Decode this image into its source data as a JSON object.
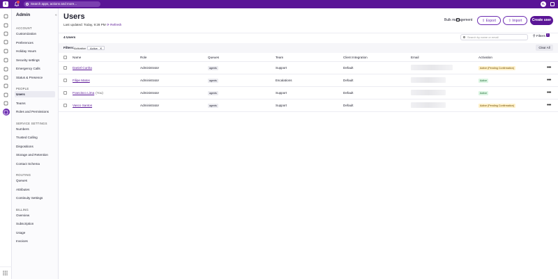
{
  "topbar": {
    "logo_text": "t",
    "search_placeholder": "Search apps, actions and more...",
    "avatar_initials": "FL"
  },
  "rail_icons": [
    "home-icon",
    "workflows-icon",
    "chat-icon",
    "org-chart-icon",
    "book-icon",
    "code-icon",
    "edit-icon",
    "phone-icon",
    "scale-icon",
    "cloud-icon",
    "compass-icon",
    "admin-settings-icon"
  ],
  "sidebar": {
    "title": "Admin",
    "sections": [
      {
        "label": "ACCOUNT",
        "items": [
          "Customization",
          "Preferences",
          "Holiday Hours",
          "Security settings",
          "Emergency Calls",
          "Status & Presence"
        ]
      },
      {
        "label": "PEOPLE",
        "items": [
          "Users",
          "Teams",
          "Roles and Permissions"
        ]
      },
      {
        "label": "SERVICE SETTINGS",
        "items": [
          "Numbers",
          "Trusted Calling",
          "Dispositions",
          "Storage and Retention",
          "Contact Schema"
        ]
      },
      {
        "label": "ROUTING",
        "items": [
          "Queues",
          "Attributes",
          "Continuity Settings"
        ]
      },
      {
        "label": "BILLING",
        "items": [
          "Overview",
          "Subscription",
          "Usage",
          "Invoices"
        ]
      }
    ],
    "active_item": "Users"
  },
  "main": {
    "title": "Users",
    "last_updated": "Last updated: Today, 9:28 PM",
    "refresh_label": "Refresh",
    "bulk_label": "Bulk management",
    "export_label": "Export",
    "import_label": "Import",
    "create_label": "Create user",
    "count_label": "4 Users",
    "search_placeholder": "Search by name or email",
    "filters_label": "Filters",
    "filters_count": "1",
    "filter_prefix": "Filters:",
    "filter_field": "Activation",
    "filter_value": "Active",
    "filter_remove": "✕",
    "clear_all_label": "Clear All"
  },
  "table": {
    "columns": [
      "Name",
      "Role",
      "Queues",
      "Team",
      "Client Integration",
      "Email",
      "Activation"
    ],
    "rows": [
      {
        "name": "Daniel Cunha",
        "suffix": "",
        "role": "Administrator",
        "queue": "agents",
        "team": "Support",
        "integration": "Default",
        "activation": "Active (Pending Confirmation)",
        "status": "pending"
      },
      {
        "name": "Filipe Matos",
        "suffix": "",
        "role": "Administrator",
        "queue": "agents",
        "team": "Escalations",
        "integration": "Default",
        "activation": "Active",
        "status": "active"
      },
      {
        "name": "Francisco Lima",
        "suffix": "(You)",
        "role": "Administrator",
        "queue": "agents",
        "team": "Support",
        "integration": "Default",
        "activation": "Active",
        "status": "active"
      },
      {
        "name": "Vasco Santos",
        "suffix": "",
        "role": "Administrator",
        "queue": "agents",
        "team": "Support",
        "integration": "Default",
        "activation": "Active (Pending Confirmation)",
        "status": "pending"
      }
    ]
  },
  "colors": {
    "brand": "#5a1596",
    "pending_bg": "#fff1c9",
    "active_bg": "#dcf5e3"
  }
}
